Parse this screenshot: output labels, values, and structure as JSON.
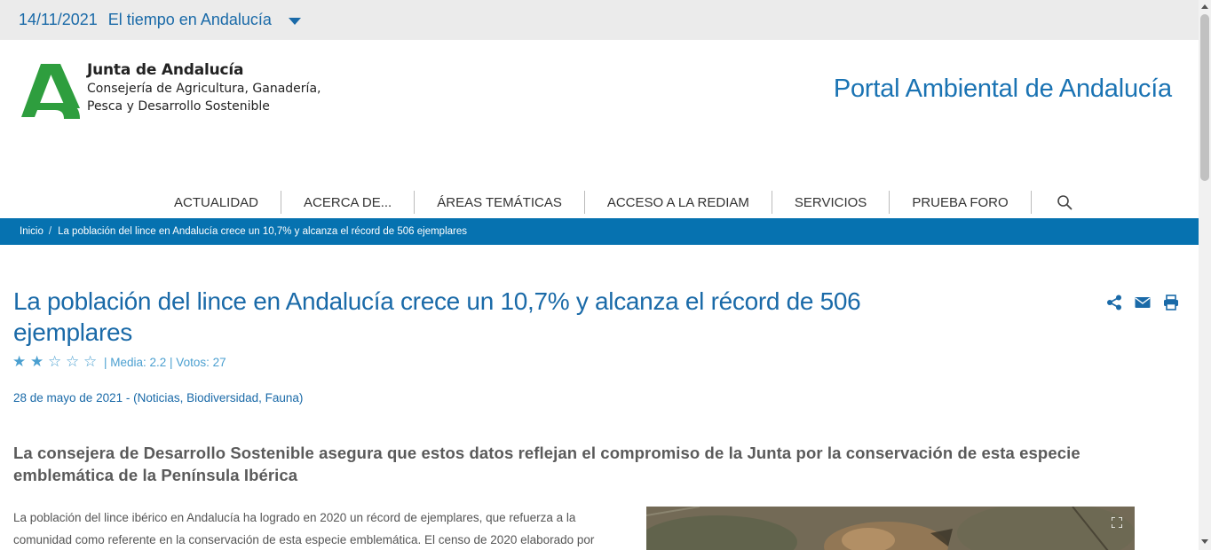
{
  "topbar": {
    "date": "14/11/2021",
    "weather_link": "El tiempo en Andalucía",
    "dropdown_icon": "caret-down-icon"
  },
  "header": {
    "org_name": "Junta de Andalucía",
    "org_sub_1": "Consejería de Agricultura, Ganadería,",
    "org_sub_2": "Pesca y Desarrollo Sostenible",
    "portal_title": "Portal Ambiental de Andalucía",
    "brand_green": "#2e9e3e",
    "brand_blue": "#0672b0"
  },
  "nav": {
    "items": [
      {
        "label": "ACTUALIDAD"
      },
      {
        "label": "ACERCA DE..."
      },
      {
        "label": "ÁREAS TEMÁTICAS"
      },
      {
        "label": "ACCESO A LA REDIAM"
      },
      {
        "label": "SERVICIOS"
      },
      {
        "label": "PRUEBA FORO"
      }
    ],
    "search_icon": "search-icon"
  },
  "breadcrumb": {
    "home": "Inicio",
    "separator": "/",
    "current": "La población del lince en Andalucía crece un 10,7% y alcanza el récord de 506 ejemplares"
  },
  "article": {
    "title": "La población del lince en Andalucía crece un 10,7% y alcanza el récord de 506 ejemplares",
    "rating": {
      "stars_filled": 2,
      "stars_total": 5,
      "meta": "| Media: 2.2 | Votos: 27"
    },
    "dateline": "28 de mayo de 2021 - (Noticias, Biodiversidad, Fauna)",
    "lead": "La consejera de Desarrollo Sostenible asegura que estos datos reflejan el compromiso de la Junta por la conservación de esta especie emblemática de la Península Ibérica",
    "body_line_1": "La población del lince ibérico en Andalucía ha logrado en 2020 un récord de ejemplares, que refuerza a la",
    "body_line_2": "comunidad como referente en la conservación de esta especie emblemática. El censo de 2020 elaborado por",
    "tools": [
      "share-icon",
      "email-icon",
      "print-icon"
    ],
    "photo_expand_icon": "expand-icon"
  }
}
